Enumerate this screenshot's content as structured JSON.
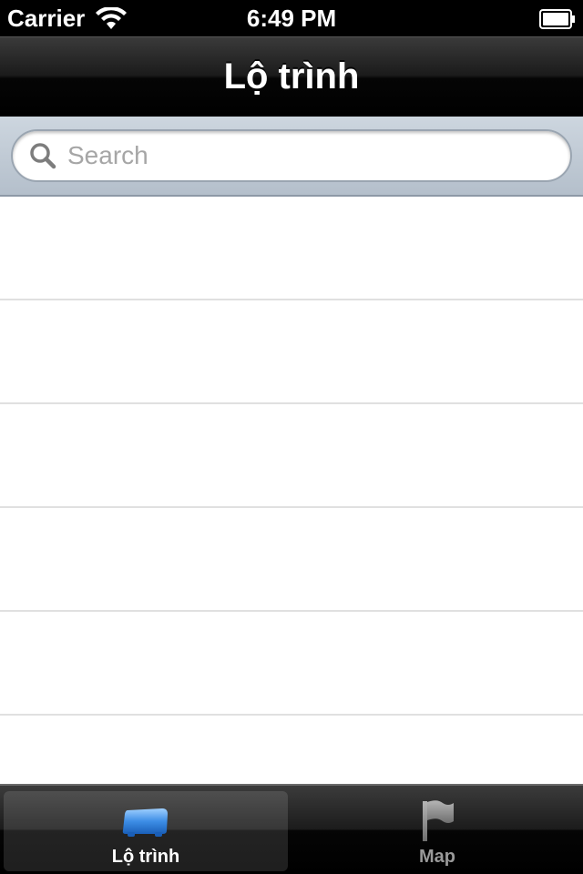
{
  "status_bar": {
    "carrier": "Carrier",
    "time": "6:49 PM",
    "wifi_icon": "wifi-icon",
    "battery_icon": "battery-icon"
  },
  "nav_bar": {
    "title": "Lộ trình"
  },
  "search": {
    "placeholder": "Search",
    "value": "",
    "icon": "search-icon"
  },
  "table": {
    "rows": [
      {
        "text": ""
      },
      {
        "text": ""
      },
      {
        "text": ""
      },
      {
        "text": ""
      },
      {
        "text": ""
      },
      {
        "text": ""
      }
    ]
  },
  "tab_bar": {
    "tabs": [
      {
        "label": "Lộ trình",
        "icon": "bus-icon",
        "selected": true,
        "color": "#3d8ee6"
      },
      {
        "label": "Map",
        "icon": "flag-icon",
        "selected": false,
        "color": "#8a8a8a"
      }
    ]
  }
}
